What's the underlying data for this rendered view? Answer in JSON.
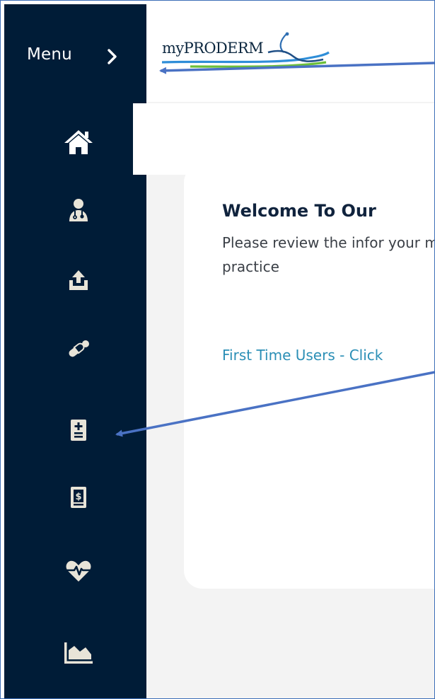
{
  "sidebar": {
    "menu_label": "Menu",
    "items": [
      {
        "name": "home",
        "icon": "home-icon"
      },
      {
        "name": "providers",
        "icon": "doctor-icon"
      },
      {
        "name": "upload",
        "icon": "upload-icon"
      },
      {
        "name": "prescriptions",
        "icon": "pills-icon"
      },
      {
        "name": "medical-records",
        "icon": "medical-file-icon"
      },
      {
        "name": "billing",
        "icon": "invoice-dollar-icon"
      },
      {
        "name": "health",
        "icon": "heartbeat-icon"
      },
      {
        "name": "reports",
        "icon": "area-chart-icon"
      }
    ]
  },
  "header": {
    "logo_text": "myPRODERM"
  },
  "main": {
    "welcome_title": "Welcome To Our",
    "intro_text": "Please review the infor your medical practice",
    "first_time_link": "First Time Users - Click"
  },
  "colors": {
    "sidebar_bg": "#001c37",
    "icon": "#e8e4d8",
    "link": "#2b8fb6",
    "annotation_arrow": "#4a72c4"
  }
}
